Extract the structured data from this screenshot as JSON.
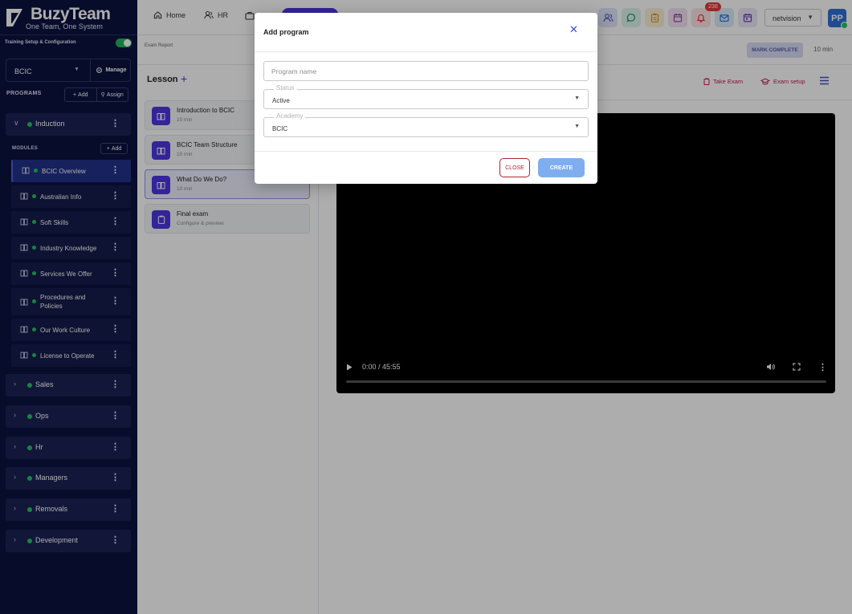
{
  "brand": {
    "name": "BuzyTeam",
    "tagline": "One Team, One System"
  },
  "sidebar": {
    "setup_label": "Training Setup & Configuration",
    "academy_value": "BCIC",
    "manage_label": "Manage",
    "programs_label": "PROGRAMS",
    "add_label": "Add",
    "assign_label": "Assign",
    "modules_label": "MODULES",
    "module_add_label": "Add",
    "expanded_program": "Induction",
    "modules": [
      {
        "label": "BCIC Overview"
      },
      {
        "label": "Australian Info"
      },
      {
        "label": "Soft Skills"
      },
      {
        "label": "Industry Knowledge"
      },
      {
        "label": "Services We Offer"
      },
      {
        "label": "Procedures and Policies"
      },
      {
        "label": "Our Work Culture"
      },
      {
        "label": "License to Operate"
      }
    ],
    "programs": [
      {
        "label": "Sales"
      },
      {
        "label": "Ops"
      },
      {
        "label": "Hr"
      },
      {
        "label": "Managers"
      },
      {
        "label": "Removals"
      },
      {
        "label": "Development"
      }
    ]
  },
  "topbar": {
    "home_label": "Home",
    "hr_label": "HR",
    "notification_count": "238",
    "workspace_value": "netvision",
    "avatar_initials": "PP"
  },
  "subbar": {
    "breadcrumb": "Exam Report",
    "mark_complete": "MARK COMPLETE",
    "duration": "10 min"
  },
  "lessons": {
    "heading": "Lesson",
    "items": [
      {
        "title": "Introduction to BCIC",
        "meta": "10 min"
      },
      {
        "title": "BCIC Team Structure",
        "meta": "10 min"
      },
      {
        "title": "What Do We Do?",
        "meta": "10 min"
      },
      {
        "title": "Final exam",
        "meta": "Configure & preview"
      }
    ]
  },
  "content": {
    "take_exam": "Take Exam",
    "exam_setup": "Exam setup",
    "video_time": "0:00 / 45:55"
  },
  "modal": {
    "title": "Add program",
    "program_name_placeholder": "Program name",
    "status_label": "Status",
    "status_value": "Active",
    "academy_label": "Academy",
    "academy_value": "BCIC",
    "close_label": "CLOSE",
    "create_label": "CREATE"
  },
  "colors": {
    "sidebar_bg": "#0c1340",
    "accent": "#4c35e0",
    "create_button": "#7faeee",
    "close_button": "#b0232e",
    "status_dot": "#22c55e",
    "badge": "#e53935"
  }
}
